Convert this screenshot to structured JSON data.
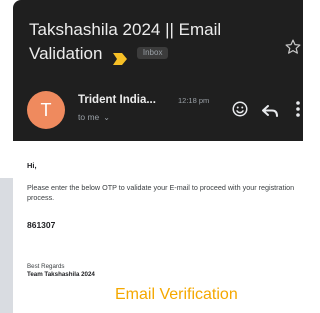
{
  "email": {
    "subject_line1": "Takshashila 2024 || Email",
    "subject_line2": "Validation",
    "label_chip": "Inbox",
    "sender": {
      "avatar_letter": "T",
      "name": "Trident India...",
      "time": "12:18 pm",
      "recipient": "to me"
    },
    "body": {
      "greeting": "Hi,",
      "message": "Please enter the below OTP to validate your E-mail to proceed with your registration process.",
      "otp": "861307",
      "closing": "Best Regards",
      "signature": "Team Takshashila 2024"
    }
  },
  "icons": {
    "important": "important-marker-icon",
    "star": "star-icon",
    "emoji": "emoji-react-icon",
    "reply": "reply-icon",
    "more": "more-vert-icon",
    "recipient_expand": "chevron-down-icon"
  },
  "caption": "Email Verification",
  "colors": {
    "header_bg": "#1f1f1f",
    "avatar": "#ef8a5e",
    "important_marker": "#f6bf26",
    "caption": "#f5a800",
    "body_bg": "#ffffff"
  }
}
